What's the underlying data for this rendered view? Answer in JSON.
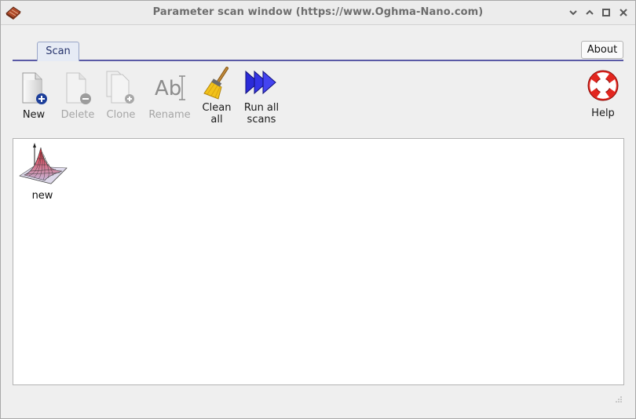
{
  "window": {
    "title": "Parameter scan window (https://www.Oghma-Nano.com)",
    "controls": [
      "chevron-down",
      "chevron-up",
      "maximize",
      "close"
    ]
  },
  "tabs": [
    {
      "label": "Scan",
      "selected": true
    }
  ],
  "about_label": "About",
  "toolbar": {
    "new": {
      "label": "New",
      "enabled": true
    },
    "delete": {
      "label": "Delete",
      "enabled": false
    },
    "clone": {
      "label": "Clone",
      "enabled": false
    },
    "rename": {
      "label": "Rename",
      "enabled": false
    },
    "clean_all": {
      "line1": "Clean",
      "line2": "all",
      "enabled": true
    },
    "run_all": {
      "line1": "Run all",
      "line2": "scans",
      "enabled": true
    },
    "help": {
      "label": "Help",
      "enabled": true
    }
  },
  "scans": [
    {
      "name": "new",
      "icon": "surface-plot-icon"
    }
  ],
  "colors": {
    "accent": "#5a5aa6",
    "tab_text": "#26336c",
    "run_arrow": "#2b2bd8",
    "help_ring": "#e3261f"
  }
}
